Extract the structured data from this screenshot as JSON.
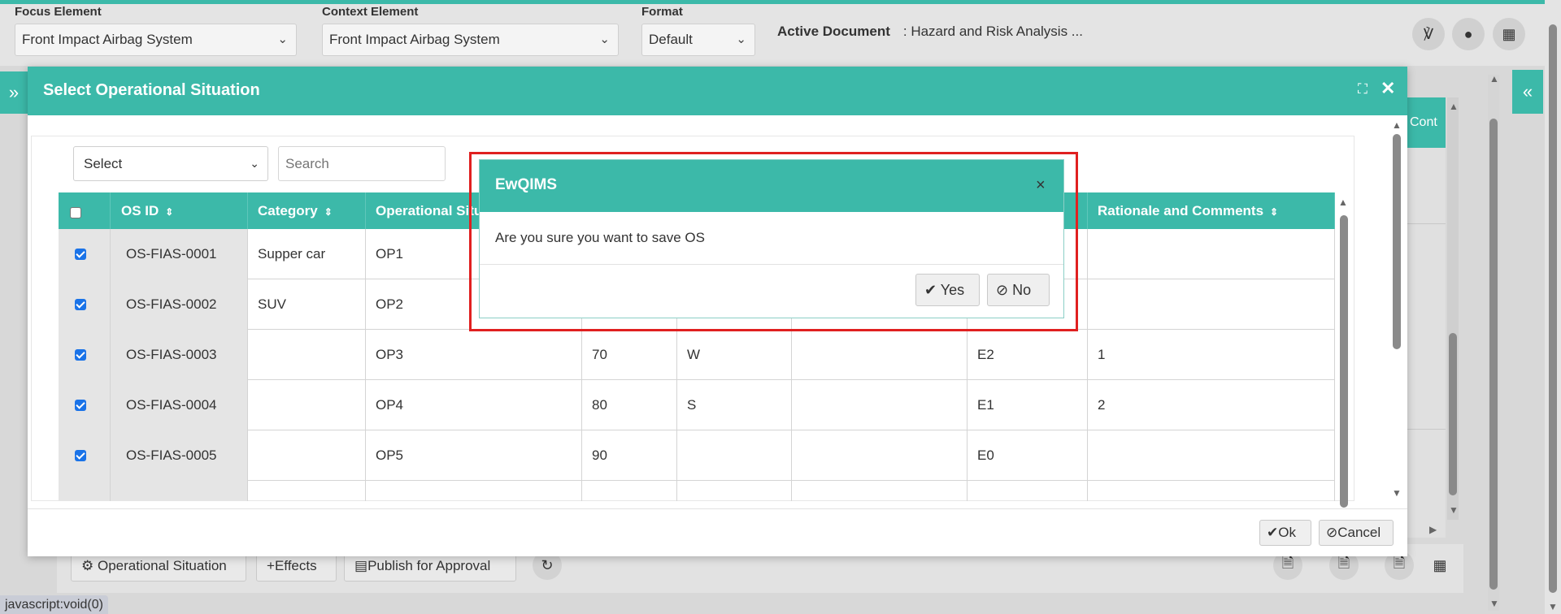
{
  "toolbar": {
    "focus_label": "Focus Element",
    "focus_value": "Front Impact Airbag System",
    "context_label": "Context Element",
    "context_value": "Front Impact Airbag System",
    "format_label": "Format",
    "format_value": "Default",
    "active_doc_label": "Active Document",
    "active_doc_value": ": Hazard and Risk Analysis ..."
  },
  "background": {
    "cont_tab": "Cont",
    "buttons": {
      "operational_situation": "Operational Situation",
      "effects": "Effects",
      "publish": "Publish for Approval"
    },
    "status_text": "javascript:void(0)"
  },
  "modal": {
    "title": "Select Operational Situation",
    "filter_select": "Select",
    "search_placeholder": "Search",
    "columns": [
      "OS ID",
      "Category",
      "Operational Situation",
      "",
      "",
      "",
      "",
      "Rationale and Comments"
    ],
    "rows": [
      {
        "checked": true,
        "os_id": "OS-FIAS-0001",
        "category": "Supper car",
        "op": "OP1",
        "c4": "",
        "c5": "",
        "c6": "",
        "c7": "",
        "rationale": ""
      },
      {
        "checked": true,
        "os_id": "OS-FIAS-0002",
        "category": "SUV",
        "op": "OP2",
        "c4": "",
        "c5": "",
        "c6": "",
        "c7": "",
        "rationale": ""
      },
      {
        "checked": true,
        "os_id": "OS-FIAS-0003",
        "category": "",
        "op": "OP3",
        "c4": "70",
        "c5": "W",
        "c6": "",
        "c7": "E2",
        "rationale": "1"
      },
      {
        "checked": true,
        "os_id": "OS-FIAS-0004",
        "category": "",
        "op": "OP4",
        "c4": "80",
        "c5": "S",
        "c6": "",
        "c7": "E1",
        "rationale": "2"
      },
      {
        "checked": true,
        "os_id": "OS-FIAS-0005",
        "category": "",
        "op": "OP5",
        "c4": "90",
        "c5": "",
        "c6": "",
        "c7": "E0",
        "rationale": ""
      }
    ],
    "ok_label": "Ok",
    "cancel_label": "Cancel"
  },
  "dialog": {
    "title": "EwQIMS",
    "message": "Are you sure you want to save OS",
    "yes_label": "Yes",
    "no_label": "No"
  },
  "colors": {
    "accent": "#3cb9a9",
    "highlight_frame": "#e02020",
    "checkbox": "#1a73e8"
  }
}
